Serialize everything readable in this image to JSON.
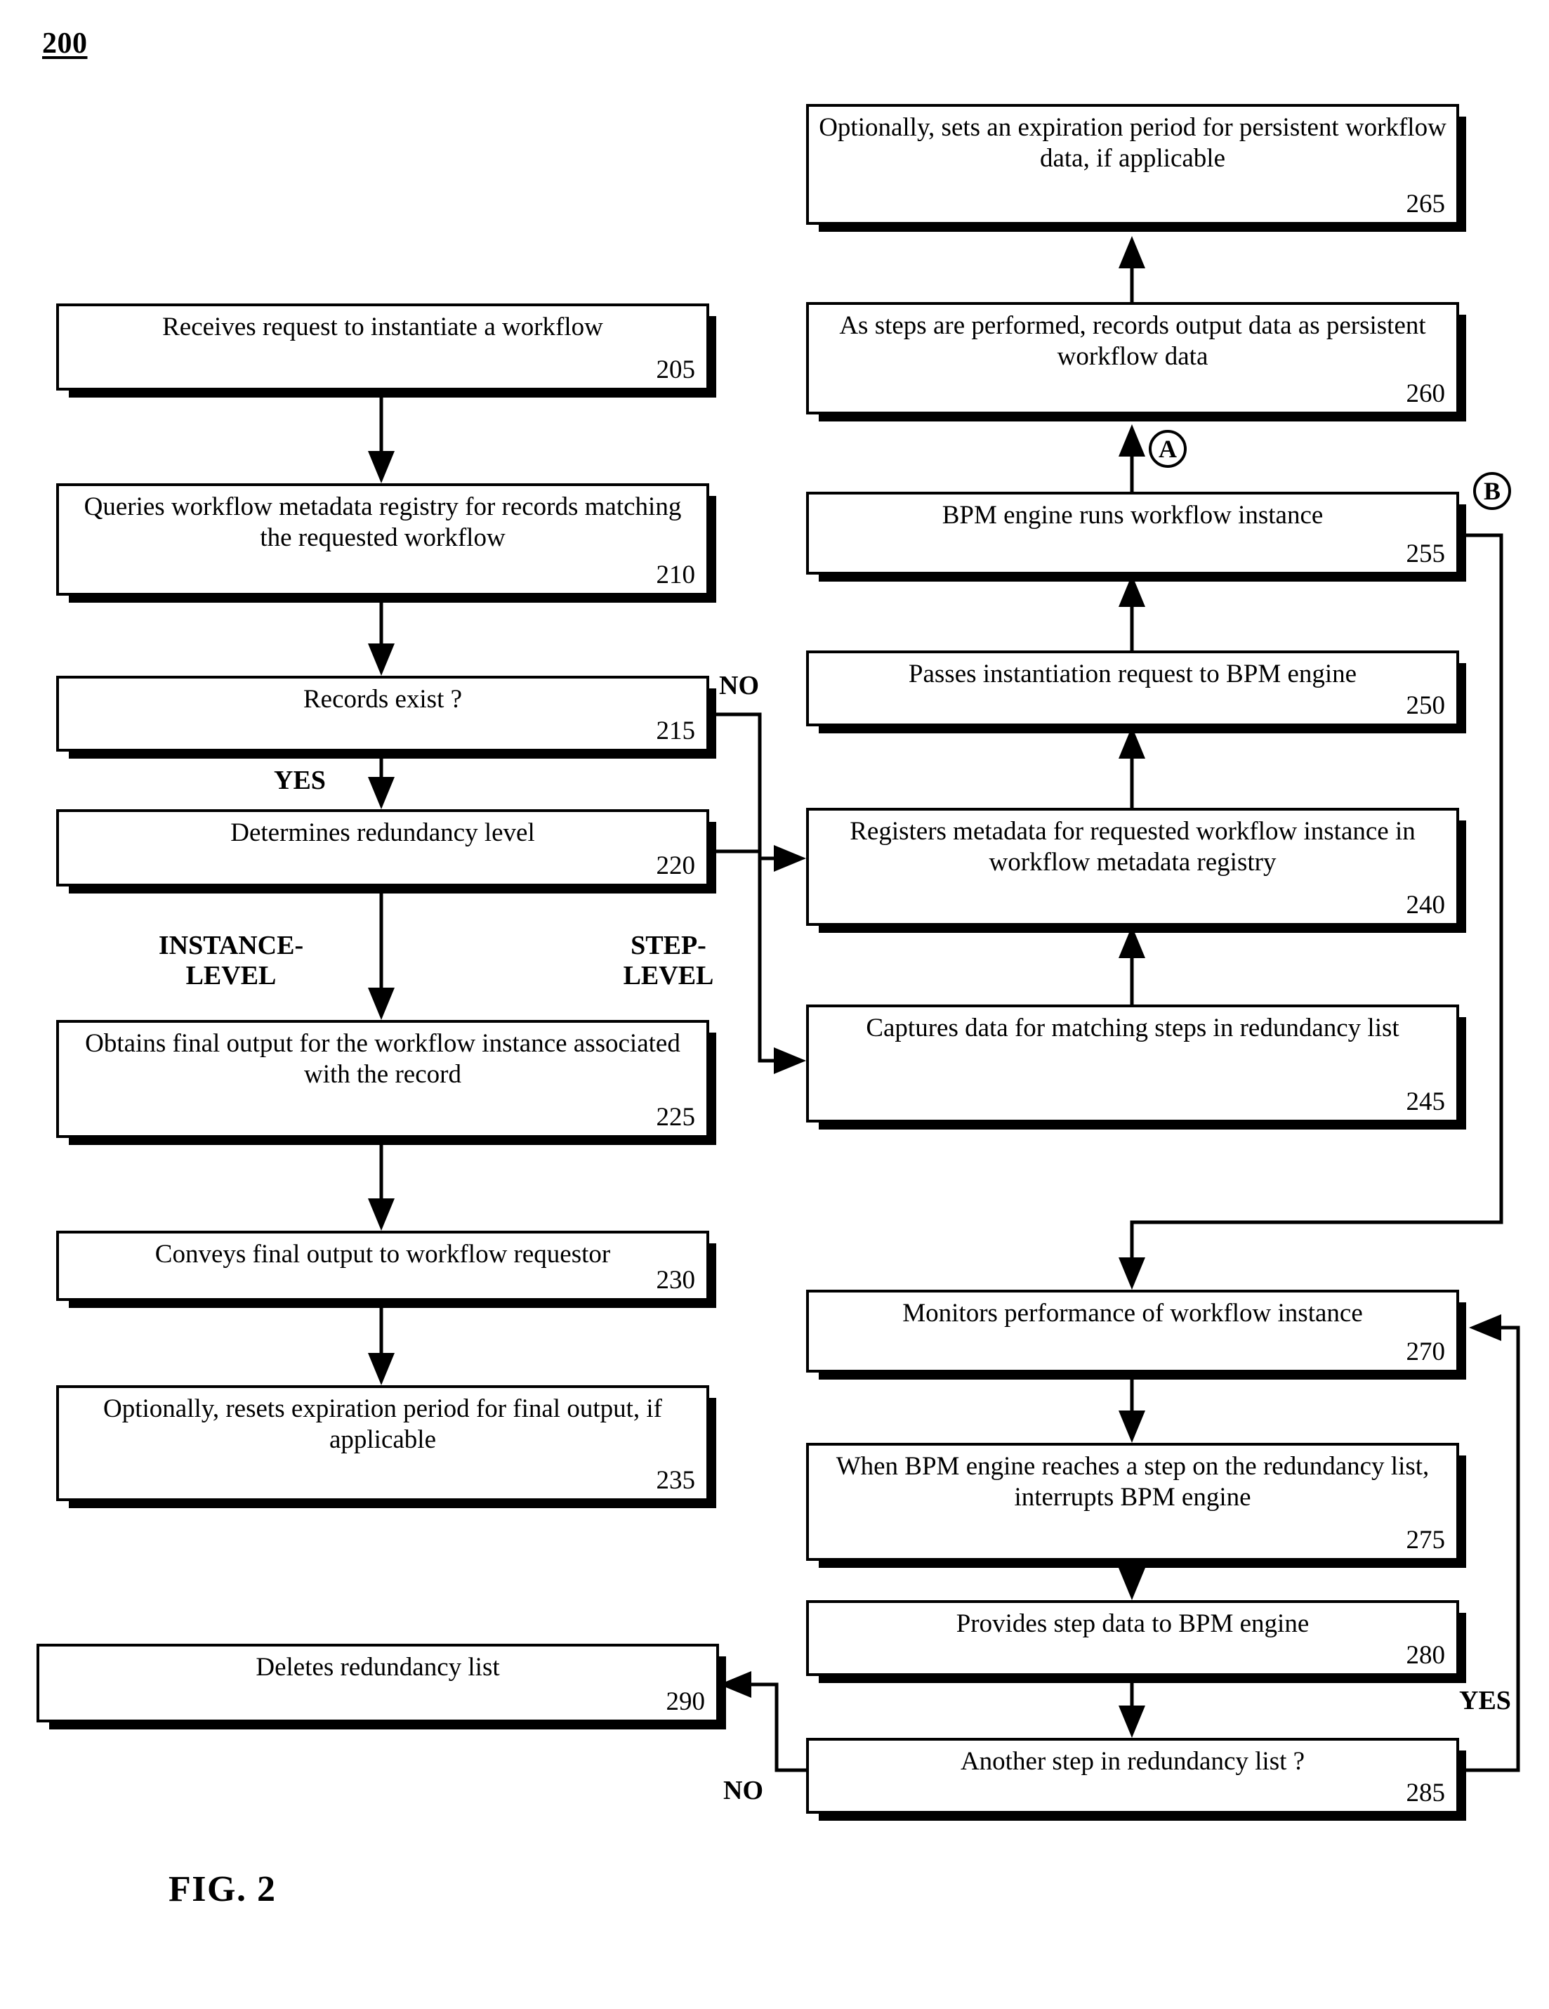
{
  "figure": {
    "number": "200",
    "caption": "FIG. 2"
  },
  "boxes": [
    {
      "id": "b205",
      "text": "Receives request to instantiate a workflow",
      "ref": "205"
    },
    {
      "id": "b210",
      "text": "Queries workflow metadata registry for records matching the requested workflow",
      "ref": "210"
    },
    {
      "id": "b215",
      "text": "Records exist ?",
      "ref": "215"
    },
    {
      "id": "b220",
      "text": "Determines redundancy level",
      "ref": "220"
    },
    {
      "id": "b225",
      "text": "Obtains final output for the workflow instance associated with the record",
      "ref": "225"
    },
    {
      "id": "b230",
      "text": "Conveys final output to workflow requestor",
      "ref": "230"
    },
    {
      "id": "b235",
      "text": "Optionally, resets expiration period for final output, if applicable",
      "ref": "235"
    },
    {
      "id": "b240",
      "text": "Registers metadata for requested workflow instance in workflow metadata registry",
      "ref": "240"
    },
    {
      "id": "b245",
      "text": "Captures data for matching steps in redundancy list",
      "ref": "245"
    },
    {
      "id": "b250",
      "text": "Passes instantiation request to BPM engine",
      "ref": "250"
    },
    {
      "id": "b255",
      "text": "BPM engine runs workflow instance",
      "ref": "255"
    },
    {
      "id": "b260",
      "text": "As steps are performed, records output data as persistent workflow data",
      "ref": "260"
    },
    {
      "id": "b265",
      "text": "Optionally, sets an expiration period for persistent workflow data, if applicable",
      "ref": "265"
    },
    {
      "id": "b270",
      "text": "Monitors performance of workflow instance",
      "ref": "270"
    },
    {
      "id": "b275",
      "text": "When BPM engine reaches a step on the redundancy list, interrupts BPM engine",
      "ref": "275"
    },
    {
      "id": "b280",
      "text": "Provides step data to BPM engine",
      "ref": "280"
    },
    {
      "id": "b285",
      "text": "Another step in redundancy list ?",
      "ref": "285"
    },
    {
      "id": "b290",
      "text": "Deletes redundancy list",
      "ref": "290"
    }
  ],
  "labels": {
    "no_215": "NO",
    "yes_215": "YES",
    "instance_level": "INSTANCE-\nLEVEL",
    "step_level": "STEP-\nLEVEL",
    "yes_285": "YES",
    "no_285": "NO"
  },
  "connectors": {
    "a": "A",
    "b": "B"
  },
  "chart_data": {
    "type": "diagram",
    "title": "FIG. 2 — Workflow redundancy process flowchart 200",
    "nodes": [
      {
        "ref": "205",
        "label": "Receives request to instantiate a workflow"
      },
      {
        "ref": "210",
        "label": "Queries workflow metadata registry for records matching the requested workflow"
      },
      {
        "ref": "215",
        "label": "Records exist ?",
        "kind": "decision"
      },
      {
        "ref": "220",
        "label": "Determines redundancy level",
        "kind": "decision"
      },
      {
        "ref": "225",
        "label": "Obtains final output for the workflow instance associated with the record"
      },
      {
        "ref": "230",
        "label": "Conveys final output to workflow requestor"
      },
      {
        "ref": "235",
        "label": "Optionally, resets expiration period for final output, if applicable"
      },
      {
        "ref": "240",
        "label": "Registers metadata for requested workflow instance in workflow metadata registry"
      },
      {
        "ref": "245",
        "label": "Captures data for matching steps in redundancy list"
      },
      {
        "ref": "250",
        "label": "Passes instantiation request to BPM engine"
      },
      {
        "ref": "255",
        "label": "BPM engine runs workflow instance"
      },
      {
        "ref": "260",
        "label": "As steps are performed, records output data as persistent workflow data"
      },
      {
        "ref": "265",
        "label": "Optionally, sets an expiration period for persistent workflow data, if applicable"
      },
      {
        "ref": "270",
        "label": "Monitors performance of workflow instance"
      },
      {
        "ref": "275",
        "label": "When BPM engine reaches a step on the redundancy list, interrupts BPM engine"
      },
      {
        "ref": "280",
        "label": "Provides step data to BPM engine"
      },
      {
        "ref": "285",
        "label": "Another step in redundancy list ?",
        "kind": "decision"
      },
      {
        "ref": "290",
        "label": "Deletes redundancy list"
      }
    ],
    "edges": [
      {
        "from": "205",
        "to": "210"
      },
      {
        "from": "210",
        "to": "215"
      },
      {
        "from": "215",
        "to": "220",
        "label": "YES"
      },
      {
        "from": "215",
        "to": "240",
        "label": "NO"
      },
      {
        "from": "220",
        "to": "225",
        "label": "INSTANCE-LEVEL"
      },
      {
        "from": "220",
        "to": "245",
        "label": "STEP-LEVEL"
      },
      {
        "from": "225",
        "to": "230"
      },
      {
        "from": "230",
        "to": "235"
      },
      {
        "from": "245",
        "to": "240"
      },
      {
        "from": "240",
        "to": "250"
      },
      {
        "from": "250",
        "to": "255"
      },
      {
        "from": "255",
        "to": "260",
        "label": "A"
      },
      {
        "from": "260",
        "to": "265"
      },
      {
        "from": "255",
        "to": "270",
        "label": "B"
      },
      {
        "from": "270",
        "to": "275"
      },
      {
        "from": "275",
        "to": "280"
      },
      {
        "from": "280",
        "to": "285"
      },
      {
        "from": "285",
        "to": "270",
        "label": "YES"
      },
      {
        "from": "285",
        "to": "290",
        "label": "NO"
      }
    ]
  }
}
